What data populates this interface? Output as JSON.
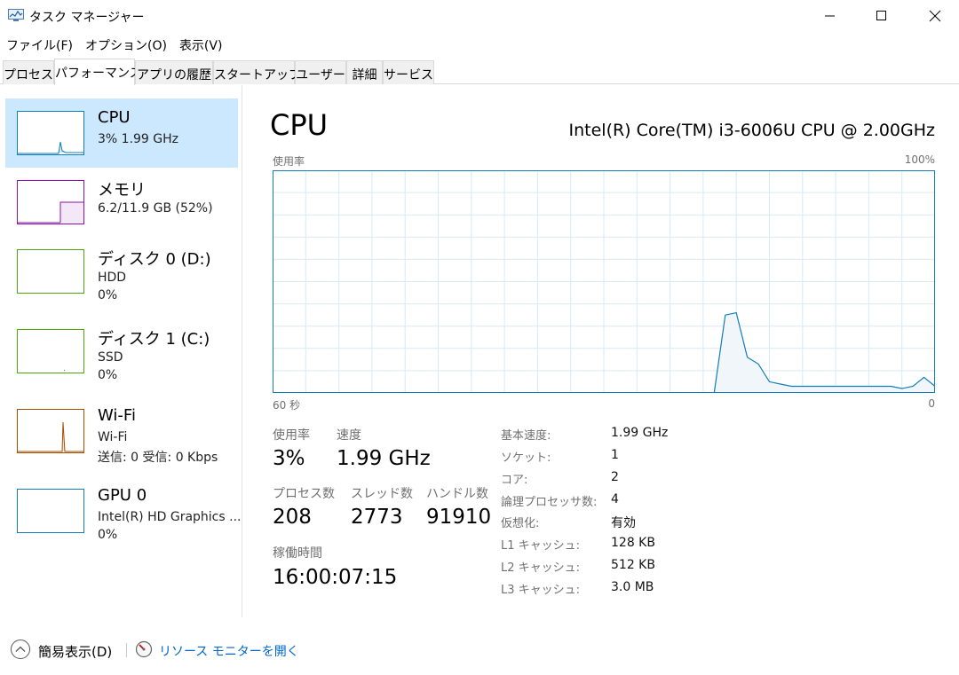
{
  "window": {
    "title": "タスク マネージャー"
  },
  "menu": [
    "ファイル(F)",
    "オプション(O)",
    "表示(V)"
  ],
  "tabs": [
    "プロセス",
    "パフォーマンス",
    "アプリの履歴",
    "スタートアップ",
    "ユーザー",
    "詳細",
    "サービス"
  ],
  "active_tab": "パフォーマンス",
  "resources": [
    {
      "name": "CPU",
      "line1": "3% 1.99 GHz",
      "line2": "",
      "color": "#117dbb",
      "selected": true
    },
    {
      "name": "メモリ",
      "line1": "6.2/11.9 GB (52%)",
      "line2": "",
      "color": "#8b12ae",
      "usage_fraction": 0.52
    },
    {
      "name": "ディスク 0 (D:)",
      "line1": "HDD",
      "line2": "0%",
      "color": "#4da60c"
    },
    {
      "name": "ディスク 1 (C:)",
      "line1": "SSD",
      "line2": "0%",
      "color": "#4da60c"
    },
    {
      "name": "Wi-Fi",
      "line1": "Wi-Fi",
      "line2": "送信: 0 受信: 0 Kbps",
      "color": "#a74f01"
    },
    {
      "name": "GPU 0",
      "line1": "Intel(R) HD Graphics ...",
      "line2": "0%",
      "color": "#117dbb"
    }
  ],
  "cpu": {
    "title": "CPU",
    "model": "Intel(R) Core(TM) i3-6006U CPU @ 2.00GHz",
    "graph_label": "使用率",
    "graph_max": "100%",
    "graph_time_left": "60 秒",
    "graph_time_right": "0",
    "stats": {
      "usage_label": "使用率",
      "usage": "3%",
      "speed_label": "速度",
      "speed": "1.99 GHz",
      "processes_label": "プロセス数",
      "processes": "208",
      "threads_label": "スレッド数",
      "threads": "2773",
      "handles_label": "ハンドル数",
      "handles": "91910",
      "uptime_label": "稼働時間",
      "uptime": "16:00:07:15"
    },
    "details": [
      {
        "key": "基本速度:",
        "value": "1.99 GHz"
      },
      {
        "key": "ソケット:",
        "value": "1"
      },
      {
        "key": "コア:",
        "value": "2"
      },
      {
        "key": "論理プロセッサ数:",
        "value": "4"
      },
      {
        "key": "仮想化:",
        "value": "有効"
      },
      {
        "key": "L1 キャッシュ:",
        "value": "128 KB"
      },
      {
        "key": "L2 キャッシュ:",
        "value": "512 KB"
      },
      {
        "key": "L3 キャッシュ:",
        "value": "3.0 MB"
      }
    ]
  },
  "chart_data": {
    "type": "area",
    "ylim": [
      0,
      100
    ],
    "x": [
      60,
      59,
      58,
      57,
      56,
      55,
      54,
      53,
      52,
      51,
      50,
      49,
      48,
      47,
      46,
      45,
      44,
      43,
      42,
      41,
      40,
      39,
      38,
      37,
      36,
      35,
      34,
      33,
      32,
      31,
      30,
      29,
      28,
      27,
      26,
      25,
      24,
      23,
      22,
      21,
      20,
      19,
      18,
      17,
      16,
      15,
      14,
      13,
      12,
      11,
      10,
      9,
      8,
      7,
      6,
      5,
      4,
      3,
      2,
      1,
      0
    ],
    "series": [
      {
        "values": [
          0,
          0,
          0,
          0,
          0,
          0,
          0,
          0,
          0,
          0,
          0,
          0,
          0,
          0,
          0,
          0,
          0,
          0,
          0,
          0,
          0,
          0,
          0,
          0,
          0,
          0,
          0,
          0,
          0,
          0,
          0,
          0,
          0,
          0,
          0,
          0,
          0,
          0,
          0,
          0,
          0,
          35,
          36,
          16,
          13,
          5,
          4,
          3,
          3,
          3,
          3,
          3,
          3,
          3,
          3,
          3,
          3,
          2,
          3,
          7,
          3
        ]
      }
    ]
  },
  "footer": {
    "fewer_details": "簡易表示(D)",
    "resource_monitor": "リソース モニターを開く"
  }
}
